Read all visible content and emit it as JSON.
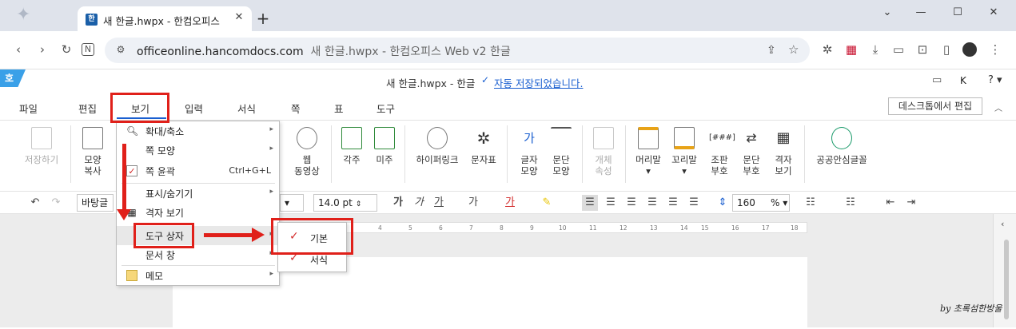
{
  "browser": {
    "tab_title": "새 한글.hwpx - 한컴오피스 Web",
    "tab_favicon": "한",
    "url_domain": "officeonline.hancomdocs.com",
    "url_rest": "새 한글.hwpx - 한컴오피스 Web v2 한글"
  },
  "app": {
    "logo": "호",
    "doc_title": "새 한글.hwpx - 한글",
    "save_status": "자동 저장되었습니다.",
    "help": "?",
    "user_initial": "K"
  },
  "menubar": {
    "items": [
      "파일",
      "편집",
      "보기",
      "입력",
      "서식",
      "쪽",
      "표",
      "도구"
    ],
    "desktop_edit": "데스크톱에서 편집"
  },
  "ribbon": {
    "save": "저장하기",
    "shape_copy": [
      "모양",
      "복사"
    ],
    "web_video": [
      "웹",
      "동영상"
    ],
    "footnote": "각주",
    "endnote": "미주",
    "hyperlink": "하이퍼링크",
    "charmap": "문자표",
    "char_shape": [
      "글자",
      "모양"
    ],
    "para_shape": [
      "문단",
      "모양"
    ],
    "object_props": [
      "개체",
      "속성"
    ],
    "header": "머리말",
    "footer": "꼬리말",
    "combine_chars": [
      "조판",
      "부호"
    ],
    "para_marks": [
      "문단",
      "부호"
    ],
    "grid_view": [
      "격자",
      "보기"
    ],
    "public_font": "공공안심글꼴"
  },
  "format": {
    "style": "바탕글",
    "font_size": "14.0",
    "font_unit": "pt",
    "line_spacing": "160",
    "line_unit": "%"
  },
  "view_menu": {
    "items": [
      {
        "label": "확대/축소",
        "icon": "magnifier-icon",
        "has_sub": true
      },
      {
        "label": "쪽 모양",
        "has_sub": true
      },
      {
        "label": "쪽 윤곽",
        "shortcut": "Ctrl+G+L",
        "checked": true
      },
      {
        "label": "표시/숨기기",
        "has_sub": true
      },
      {
        "label": "격자 보기",
        "icon": "grid-icon"
      },
      {
        "label": "도구 상자",
        "has_sub": true,
        "highlighted": true
      },
      {
        "label": "문서 창",
        "has_sub": true
      },
      {
        "label": "메모",
        "icon": "memo-icon",
        "has_sub": true
      }
    ]
  },
  "toolbox_submenu": {
    "items": [
      {
        "label": "기본",
        "checked": true
      },
      {
        "label": "서식",
        "checked": true
      }
    ]
  },
  "ruler_ticks": [
    "4",
    "5",
    "6",
    "7",
    "8",
    "9",
    "10",
    "11",
    "12",
    "13",
    "14",
    "15",
    "16",
    "17",
    "18"
  ],
  "watermark": "by 초록섬한방울",
  "colors": {
    "highlight_red": "#e0201a",
    "accent_blue": "#1a5fd0",
    "check_red": "#d32b2b"
  }
}
